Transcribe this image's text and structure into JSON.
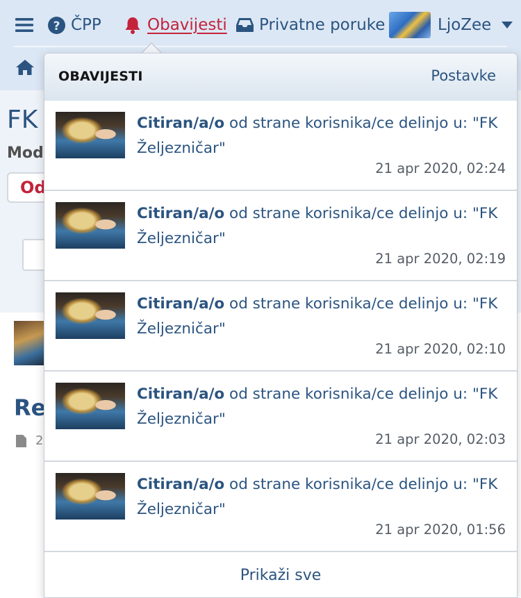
{
  "nav": {
    "cpp_label": "ČPP",
    "alerts_label": "Obavijesti",
    "messages_label": "Privatne poruke",
    "username": "LjoZee"
  },
  "background": {
    "title_fragment": "FK",
    "mod_fragment": "Mod",
    "button_fragment": "Od",
    "reply_fragment": "Re",
    "meta_fragment": "2"
  },
  "menu": {
    "title": "OBAVIJESTI",
    "settings_label": "Postavke",
    "footer_label": "Prikaži sve",
    "alerts": [
      {
        "action": "Citiran/a/o",
        "text": " od strane korisnika/ce delinjo u: \"FK Željezničar\"",
        "time": "21 apr 2020, 02:24"
      },
      {
        "action": "Citiran/a/o",
        "text": " od strane korisnika/ce delinjo u: \"FK Željezničar\"",
        "time": "21 apr 2020, 02:19"
      },
      {
        "action": "Citiran/a/o",
        "text": " od strane korisnika/ce delinjo u: \"FK Željezničar\"",
        "time": "21 apr 2020, 02:10"
      },
      {
        "action": "Citiran/a/o",
        "text": " od strane korisnika/ce delinjo u: \"FK Željezničar\"",
        "time": "21 apr 2020, 02:03"
      },
      {
        "action": "Citiran/a/o",
        "text": " od strane korisnika/ce delinjo u: \"FK Željezničar\"",
        "time": "21 apr 2020, 01:56"
      }
    ]
  },
  "colors": {
    "link": "#2b5480",
    "alert_active": "#c3233b",
    "nav_bg": "#dce7f5"
  },
  "icons": [
    "menu-icon",
    "help-icon",
    "bell-icon",
    "inbox-icon",
    "chevron-down-icon",
    "home-icon",
    "file-icon"
  ]
}
